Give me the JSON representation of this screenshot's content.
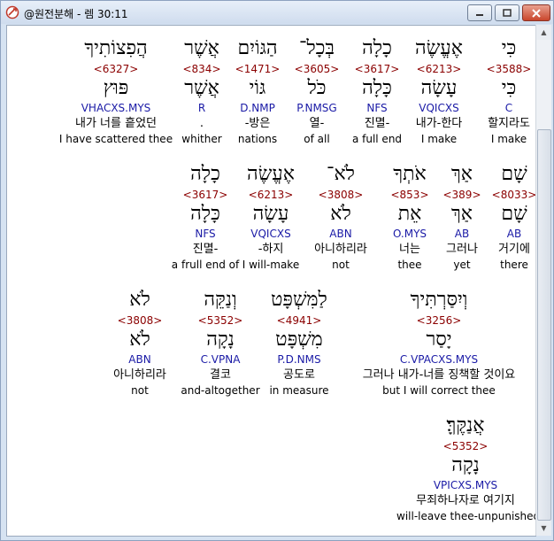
{
  "window": {
    "title": "@원전분해 - 렘 30:11",
    "buttons": {
      "minimize": "minimize-icon",
      "maximize": "maximize-icon",
      "close": "close-icon"
    }
  },
  "rows": [
    [
      {
        "heb": "כִּי",
        "snum": "<3588>",
        "root": "כִּי",
        "morph": "C",
        "kor": "할지라도",
        "eng": "I make"
      },
      {
        "heb": "אֶעֱשֶׂה",
        "snum": "<6213>",
        "root": "עָשָׂה",
        "morph": "VQICXS",
        "kor": "내가-한다",
        "eng": "I make"
      },
      {
        "heb": "כָלָה",
        "snum": "<3617>",
        "root": "כָּלָה",
        "morph": "NFS",
        "kor": "진멸-",
        "eng": "a full end"
      },
      {
        "heb": "בְּכָל־",
        "snum": "<3605>",
        "root": "כֹּל",
        "morph": "P.NMSG",
        "kor": "열-",
        "eng": "of all"
      },
      {
        "heb": "הַגּוֹיִם",
        "snum": "<1471>",
        "root": "גּוֹי",
        "morph": "D.NMP",
        "kor": "-방은",
        "eng": "nations"
      },
      {
        "heb": "אֲשֶׁר",
        "snum": "<834>",
        "root": "אֲשֶׁר",
        "morph": "R",
        "kor": ".",
        "eng": "whither"
      },
      {
        "heb": "הֲפִצוֹתִיךָ",
        "snum": "<6327>",
        "root": "פּוּץ",
        "morph": "VHACXS.MYS",
        "kor": "내가 너를 흩었던",
        "eng": "I have scattered thee"
      }
    ],
    [
      {
        "heb": "שָׁם",
        "snum": "<8033>",
        "root": "שָׁם",
        "morph": "AB",
        "kor": "거기에",
        "eng": "there"
      },
      {
        "heb": "אַךְ",
        "snum": "<389>",
        "root": "אַךְ",
        "morph": "AB",
        "kor": "그러나",
        "eng": "yet"
      },
      {
        "heb": "אֹתְךָ",
        "snum": "<853>",
        "root": "אֵת",
        "morph": "O.MYS",
        "kor": "너는",
        "eng": "thee"
      },
      {
        "heb": "לֹא־",
        "snum": "<3808>",
        "root": "לֹא",
        "morph": "ABN",
        "kor": "아니하리라",
        "eng": "not"
      },
      {
        "heb": "אֶעֱשֶׂה",
        "snum": "<6213>",
        "root": "עָשָׂה",
        "morph": "VQICXS",
        "kor": "-하지",
        "eng": "I will-make"
      },
      {
        "heb": "כָלָה",
        "snum": "<3617>",
        "root": "כָּלָה",
        "morph": "NFS",
        "kor": "진멸-",
        "eng": "a frull end of"
      }
    ],
    [
      {
        "heb": "וְיִסַּרְתִּיךָ",
        "snum": "<3256>",
        "root": "יָסַר",
        "morph": "C.VPACXS.MYS",
        "kor": "그러나 내가-너를 징책할 것이요",
        "eng": "but I will correct thee"
      },
      {
        "heb": "לַמִּשְׁפָּט",
        "snum": "<4941>",
        "root": "מִשְׁפָּט",
        "morph": "P.D.NMS",
        "kor": "공도로",
        "eng": "in measure"
      },
      {
        "heb": "וְנַקֵּה",
        "snum": "<5352>",
        "root": "נָקָה",
        "morph": "C.VPNA",
        "kor": "결코",
        "eng": "and-altogether"
      },
      {
        "heb": "לֹא",
        "snum": "<3808>",
        "root": "לֹא",
        "morph": "ABN",
        "kor": "아니하리라",
        "eng": "not"
      }
    ],
    [
      {
        "heb": "אֲנַקֶּךָּ׃",
        "snum": "<5352>",
        "root": "נָקָה",
        "morph": "VPICXS.MYS",
        "kor": "무죄하나자로 여기지",
        "eng": "will-leave thee-unpunished"
      }
    ]
  ]
}
